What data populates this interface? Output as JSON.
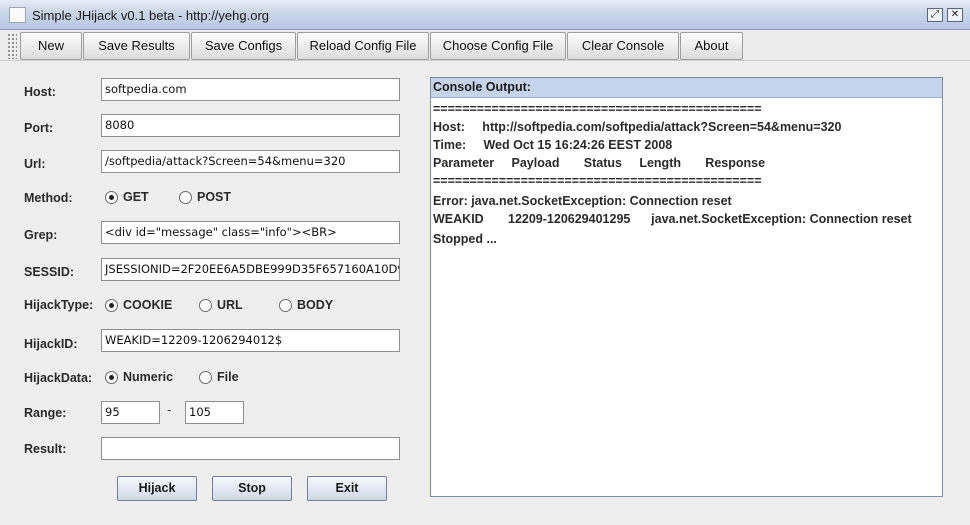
{
  "window": {
    "title": "Simple JHijack v0.1 beta - http://yehg.org",
    "restore_glyph": "⤢",
    "close_glyph": "✕"
  },
  "toolbar": {
    "buttons": [
      "New",
      "Save Results",
      "Save Configs",
      "Reload Config File",
      "Choose Config File",
      "Clear Console",
      "About"
    ]
  },
  "form": {
    "host": {
      "label": "Host:",
      "value": "softpedia.com"
    },
    "port": {
      "label": "Port:",
      "value": "8080"
    },
    "url": {
      "label": "Url:",
      "value": "/softpedia/attack?Screen=54&menu=320"
    },
    "method": {
      "label": "Method:",
      "options": [
        "GET",
        "POST"
      ],
      "selected": "GET"
    },
    "grep": {
      "label": "Grep:",
      "value": "<div id=\"message\" class=\"info\"><BR>"
    },
    "sessid": {
      "label": "SESSID:",
      "value": "JSESSIONID=2F20EE6A5DBE999D35F657160A10D9"
    },
    "hijack_type": {
      "label": "HijackType:",
      "options": [
        "COOKIE",
        "URL",
        "BODY"
      ],
      "selected": "COOKIE"
    },
    "hijack_id": {
      "label": "HijackID:",
      "value": "WEAKID=12209-1206294012$"
    },
    "hijack_data": {
      "label": "HijackData:",
      "options": [
        "Numeric",
        "File"
      ],
      "selected": "Numeric"
    },
    "range": {
      "label": "Range:",
      "from": "95",
      "separator": "-",
      "to": "105"
    },
    "result": {
      "label": "Result:",
      "value": ""
    }
  },
  "actions": {
    "hijack": "Hijack",
    "stop": "Stop",
    "exit": "Exit"
  },
  "console": {
    "header": "Console Output:",
    "lines": [
      "=============================================",
      "Host:     http://softpedia.com/softpedia/attack?Screen=54&menu=320",
      "Time:     Wed Oct 15 16:24:26 EEST 2008",
      "Parameter     Payload       Status     Length       Response",
      "=============================================",
      "",
      "Error: java.net.SocketException: Connection reset",
      "WEAKID       12209-120629401295      java.net.SocketException: Connection reset",
      "Stopped ..."
    ]
  }
}
